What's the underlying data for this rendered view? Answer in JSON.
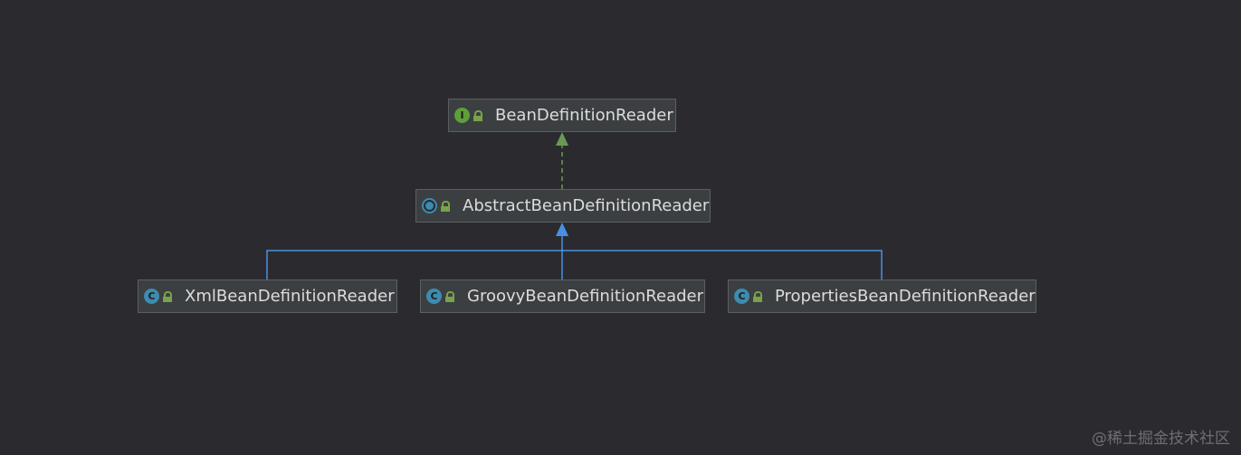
{
  "diagram": {
    "nodes": [
      {
        "id": "bdr",
        "kind": "interface",
        "badge": "I",
        "label": "BeanDefinitionReader"
      },
      {
        "id": "abdr",
        "kind": "abstract",
        "badge": "C",
        "label": "AbstractBeanDefinitionReader"
      },
      {
        "id": "xml",
        "kind": "class",
        "badge": "C",
        "label": "XmlBeanDefinitionReader"
      },
      {
        "id": "groovy",
        "kind": "class",
        "badge": "C",
        "label": "GroovyBeanDefinitionReader"
      },
      {
        "id": "props",
        "kind": "class",
        "badge": "C",
        "label": "PropertiesBeanDefinitionReader"
      }
    ],
    "edges": [
      {
        "from": "abdr",
        "to": "bdr",
        "type": "implements",
        "color": "#6a9955"
      },
      {
        "from": "xml",
        "to": "abdr",
        "type": "extends",
        "color": "#4a90e2"
      },
      {
        "from": "groovy",
        "to": "abdr",
        "type": "extends",
        "color": "#4a90e2"
      },
      {
        "from": "props",
        "to": "abdr",
        "type": "extends",
        "color": "#4a90e2"
      }
    ]
  },
  "watermark": "@稀土掘金技术社区"
}
